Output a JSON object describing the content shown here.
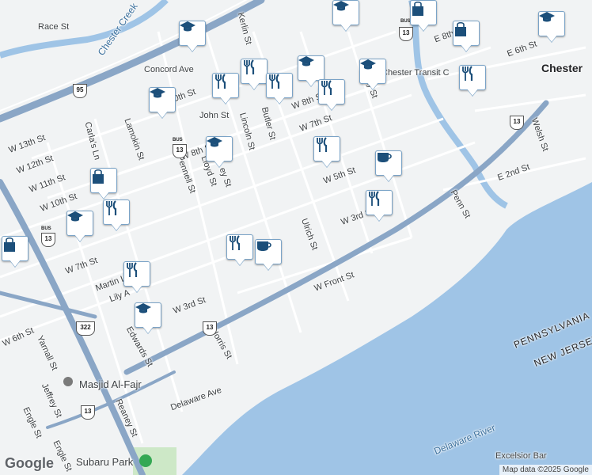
{
  "map": {
    "city_label": "Chester",
    "state_labels": [
      "PENNSYLVANIA",
      "NEW JERSEY"
    ],
    "water_labels": [
      "Delaware River",
      "Chester Creek"
    ],
    "poi_labels": [
      "Masjid Al-Fajr",
      "Subaru Park",
      "Excelsior Bar",
      "Chester Transit C"
    ],
    "streets": [
      "Race St",
      "Concord Ave",
      "W 10th St",
      "John St",
      "Kerlin St",
      "Lincoln St",
      "Butler St",
      "W 8th St",
      "W 7th St",
      "Barclay St",
      "W 5th St",
      "W 3rd St",
      "Ulrich St",
      "W Front St",
      "E 6th St",
      "E 8th St",
      "E 2nd St",
      "Penn St",
      "Welsh St",
      "W 13th St",
      "W 12th St",
      "W 11th St",
      "W 10th St",
      "Carla's Ln",
      "Lamokin St",
      "Pennell St",
      "Lloyd St",
      "W 8th St",
      "W 7th St",
      "Martin L",
      "Lily A",
      "W 3rd St",
      "Edwards St",
      "Norris St",
      "Delaware Ave",
      "W 6th St",
      "Yarnall St",
      "Jeffrey St",
      "Engle St",
      "Reaney St",
      "Engle St",
      "ey St"
    ],
    "highway_shields": [
      "95",
      "13",
      "13",
      "13",
      "13",
      "322",
      "13",
      "13"
    ],
    "bus_labels": [
      "BUS",
      "BUS",
      "BUS"
    ],
    "attribution": "Map data ©2025 Google",
    "logo": "Google"
  },
  "markers": [
    {
      "type": "school"
    },
    {
      "type": "school"
    },
    {
      "type": "school"
    },
    {
      "type": "school"
    },
    {
      "type": "school"
    },
    {
      "type": "school"
    },
    {
      "type": "school"
    },
    {
      "type": "school"
    },
    {
      "type": "school"
    },
    {
      "type": "restaurant"
    },
    {
      "type": "restaurant"
    },
    {
      "type": "restaurant"
    },
    {
      "type": "restaurant"
    },
    {
      "type": "restaurant"
    },
    {
      "type": "restaurant"
    },
    {
      "type": "restaurant"
    },
    {
      "type": "restaurant"
    },
    {
      "type": "restaurant"
    },
    {
      "type": "restaurant"
    },
    {
      "type": "shop"
    },
    {
      "type": "shop"
    },
    {
      "type": "shop"
    },
    {
      "type": "shop"
    },
    {
      "type": "cafe"
    },
    {
      "type": "cafe"
    }
  ],
  "colors": {
    "water": "#9fc4e6",
    "land": "#f1f3f4",
    "road": "#ffffff",
    "highway": "#8aa6c6",
    "park": "#cde8c7",
    "marker": "#1c4f7a"
  }
}
